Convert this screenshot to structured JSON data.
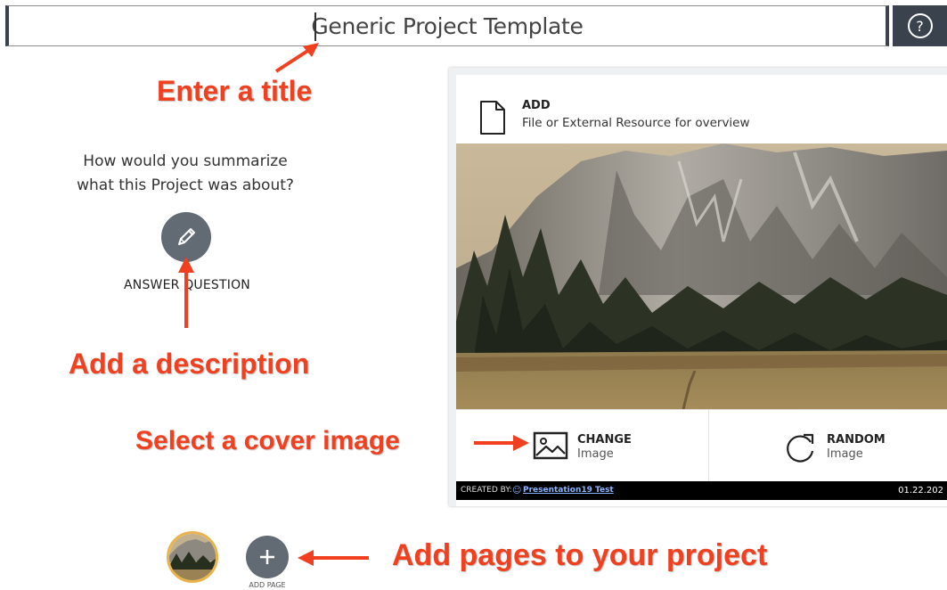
{
  "header": {
    "title_value": "Generic Project Template",
    "help_icon": "question-circle-icon"
  },
  "summary": {
    "prompt_line1": "How would you summarize",
    "prompt_line2": "what this Project was about?",
    "button_icon": "pencil-icon",
    "answer_label": "ANSWER QUESTION"
  },
  "cover_card": {
    "add_label": "ADD",
    "add_sublabel": "File or External Resource for overview",
    "file_icon": "file-icon",
    "change_label": "CHANGE",
    "change_sub": "Image",
    "change_icon": "image-icon",
    "random_label": "RANDOM",
    "random_sub": "Image",
    "random_icon": "refresh-icon",
    "credit_label": "CREATED BY:",
    "credit_user": "Presentation19 Test",
    "credit_date": "01.22.202"
  },
  "pages": {
    "add_page_label": "ADD PAGE",
    "add_icon": "plus-icon"
  },
  "annotations": {
    "title": "Enter a title",
    "description": "Add a description",
    "cover": "Select a cover image",
    "pages": "Add pages to your project"
  },
  "colors": {
    "annotation_red": "#f0401f",
    "dark_slate": "#3a434d",
    "button_gray": "#626b73",
    "thumb_ring": "#e9b44c"
  }
}
